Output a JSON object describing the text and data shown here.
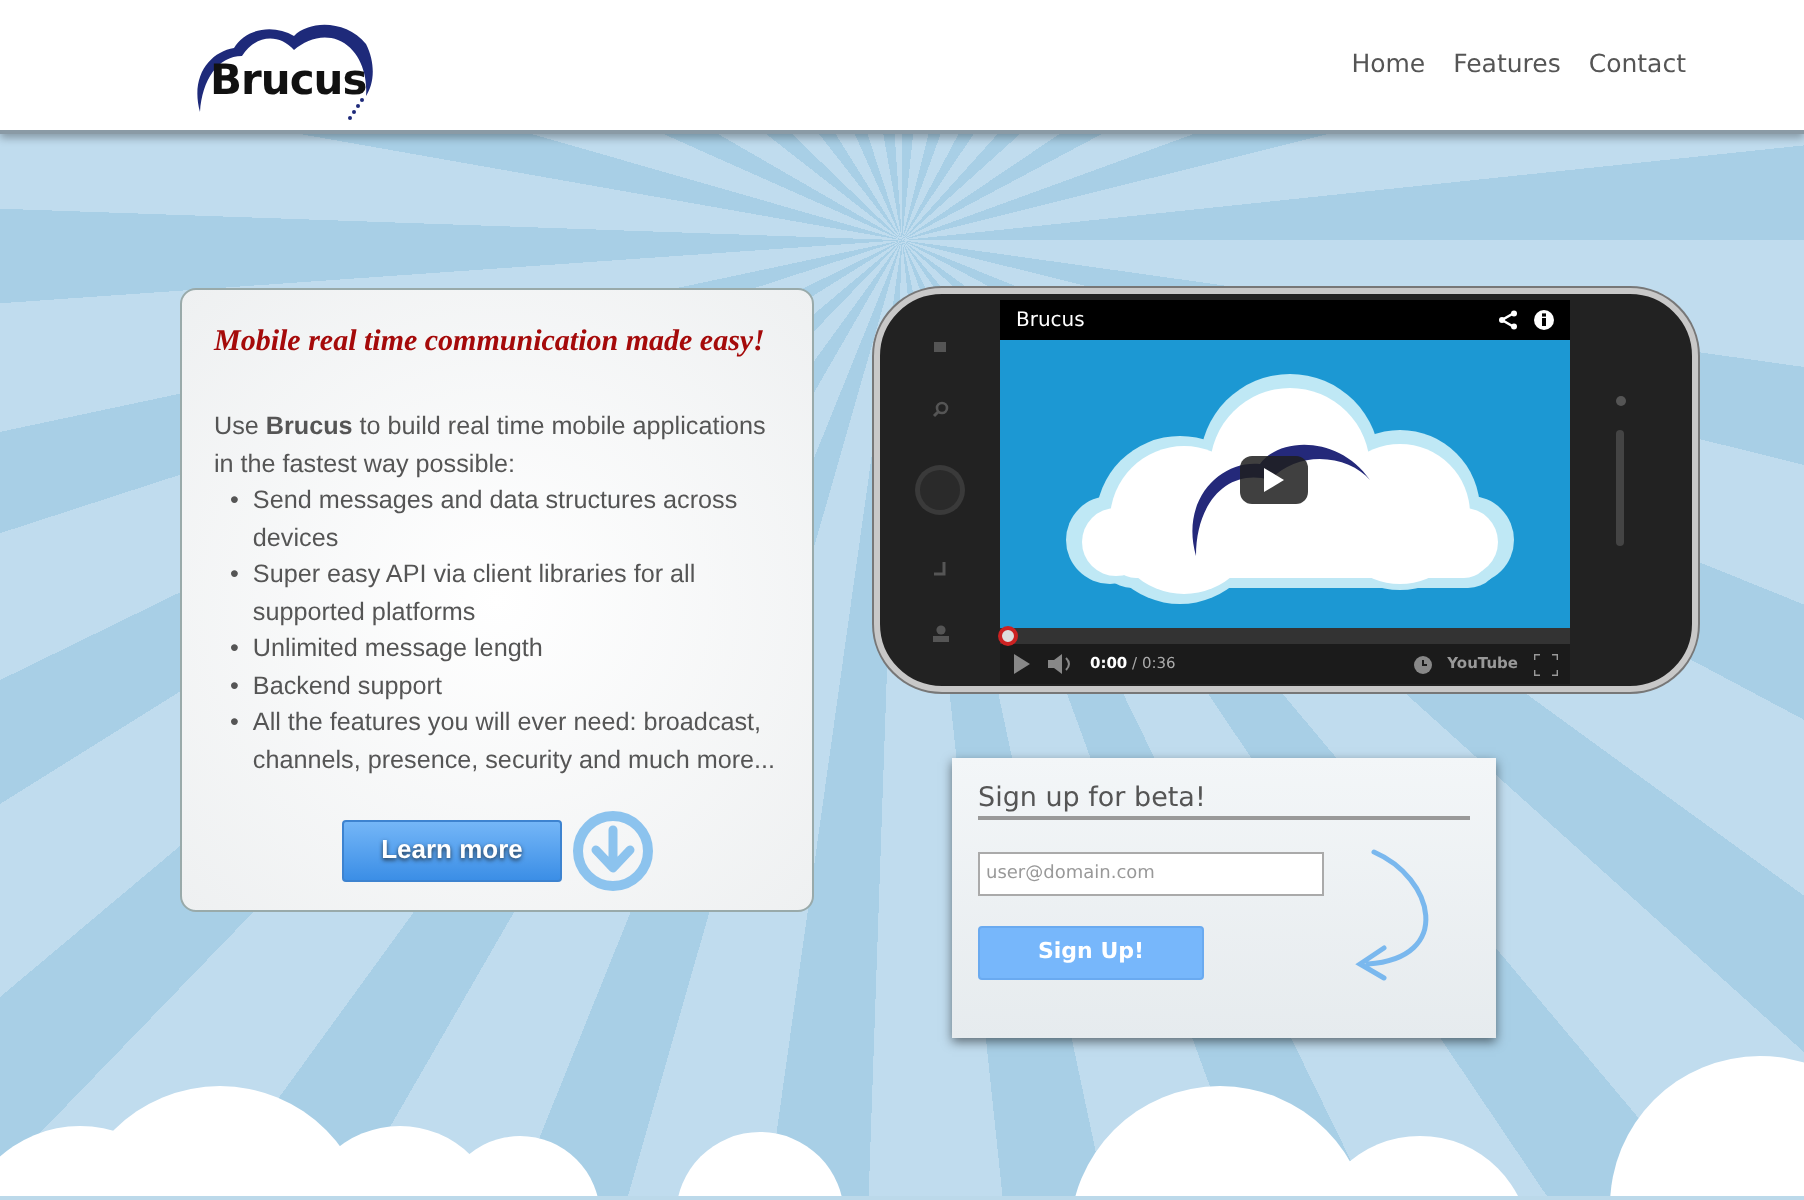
{
  "logo": {
    "text": "Brucus"
  },
  "nav": [
    {
      "label": "Home"
    },
    {
      "label": "Features"
    },
    {
      "label": "Contact"
    }
  ],
  "intro": {
    "heading": "Mobile real time communication made easy!",
    "text": "Use **Brucus** to build real time mobile applications in the fastest way possible:",
    "bullet": "•",
    "features": [
      "Send messages and data structures across devices",
      "Super easy API via client libraries for all supported platforms",
      "Unlimited message length",
      "Backend support",
      "All the features you will ever need: broadcast, channels, presence, security and much more..."
    ],
    "button": "Learn more"
  },
  "video": {
    "title": "Brucus",
    "current": "0:00",
    "duration": "/ 0:36",
    "brand": "YouTube",
    "level": 0
  },
  "signup": {
    "heading": "Sign up for beta!",
    "placeholder": "user@domain.com",
    "button": "Sign Up!"
  }
}
